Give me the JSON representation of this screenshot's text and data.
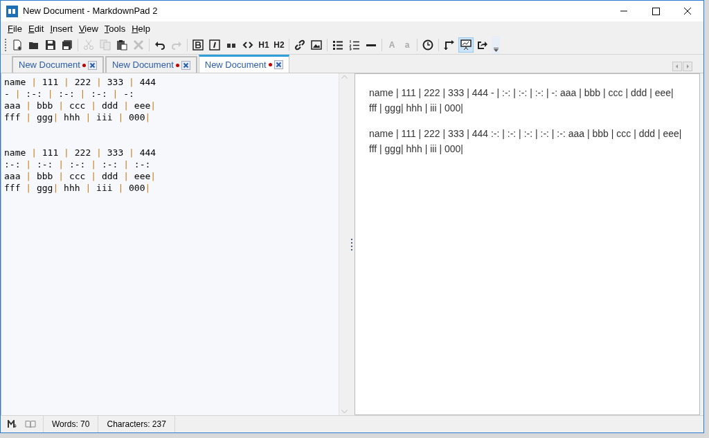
{
  "window": {
    "title": "New Document - MarkdownPad 2"
  },
  "menu": [
    "File",
    "Edit",
    "Insert",
    "View",
    "Tools",
    "Help"
  ],
  "toolbar": [
    {
      "kind": "new",
      "disabled": false
    },
    {
      "kind": "open",
      "disabled": false
    },
    {
      "kind": "save",
      "disabled": false
    },
    {
      "kind": "saveall",
      "disabled": false
    },
    {
      "kind": "sep"
    },
    {
      "kind": "cut",
      "disabled": true
    },
    {
      "kind": "copy",
      "disabled": true
    },
    {
      "kind": "paste",
      "disabled": false
    },
    {
      "kind": "delete",
      "disabled": true
    },
    {
      "kind": "sep"
    },
    {
      "kind": "undo",
      "disabled": false
    },
    {
      "kind": "redo",
      "disabled": true
    },
    {
      "kind": "sep"
    },
    {
      "kind": "bold",
      "disabled": false
    },
    {
      "kind": "italic",
      "disabled": false
    },
    {
      "kind": "quote",
      "disabled": false
    },
    {
      "kind": "code",
      "disabled": false
    },
    {
      "kind": "text",
      "label": "H1",
      "disabled": false
    },
    {
      "kind": "text",
      "label": "H2",
      "disabled": false
    },
    {
      "kind": "sep"
    },
    {
      "kind": "link",
      "disabled": false
    },
    {
      "kind": "image",
      "disabled": false
    },
    {
      "kind": "sep"
    },
    {
      "kind": "ul",
      "disabled": false
    },
    {
      "kind": "ol",
      "disabled": false
    },
    {
      "kind": "hr",
      "disabled": false
    },
    {
      "kind": "sep"
    },
    {
      "kind": "text",
      "label": "A",
      "disabled": true
    },
    {
      "kind": "text",
      "label": "a",
      "disabled": true
    },
    {
      "kind": "sep"
    },
    {
      "kind": "clock",
      "disabled": false
    },
    {
      "kind": "sep"
    },
    {
      "kind": "swap",
      "disabled": false
    },
    {
      "kind": "preview",
      "disabled": false,
      "pressed": true
    },
    {
      "kind": "export",
      "disabled": false
    }
  ],
  "tabs": [
    {
      "label": "New Document",
      "modified": true,
      "selected": false
    },
    {
      "label": "New Document",
      "modified": true,
      "selected": false
    },
    {
      "label": "New Document",
      "modified": true,
      "selected": true
    }
  ],
  "editor": {
    "blocks": [
      [
        "name | 111 | 222 | 333 | 444",
        "- | :-: | :-: | :-: | -:",
        "aaa | bbb | ccc | ddd | eee|",
        "fff | ggg| hhh | iii | 000|"
      ],
      [
        "name | 111 | 222 | 333 | 444",
        ":-: | :-: | :-: | :-: | :-:",
        "aaa | bbb | ccc | ddd | eee|",
        "fff | ggg| hhh | iii | 000|"
      ]
    ]
  },
  "preview": {
    "paragraphs": [
      "name | 111 | 222 | 333 | 444 - | :-: | :-: | :-: | -: aaa | bbb | ccc | ddd | eee| fff | ggg| hhh | iii | 000|",
      "name | 111 | 222 | 333 | 444 :-: | :-: | :-: | :-: | :-: aaa | bbb | ccc | ddd | eee| fff | ggg| hhh | iii | 000|"
    ]
  },
  "status_bar": {
    "words": "Words: 70",
    "characters": "Characters: 237"
  }
}
